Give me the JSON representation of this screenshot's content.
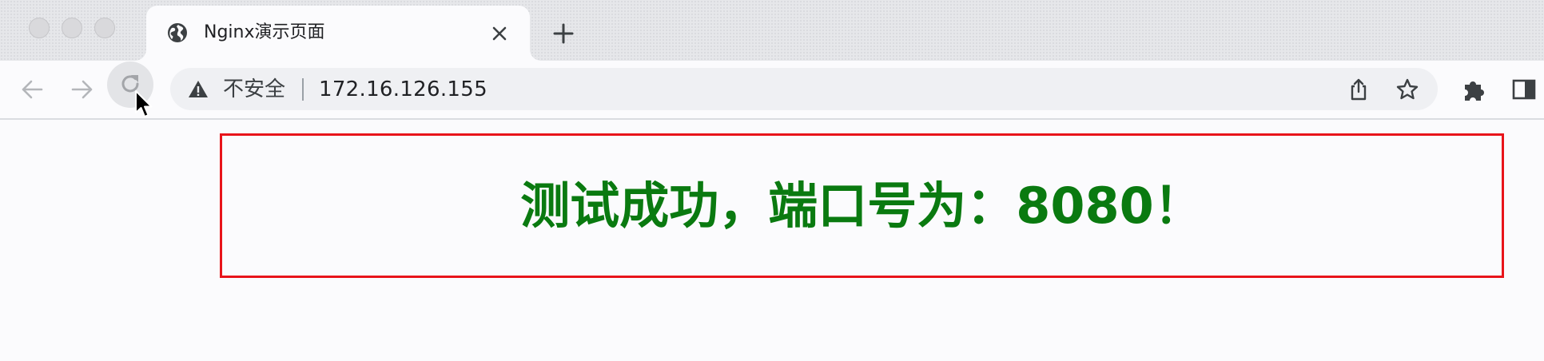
{
  "tab": {
    "title": "Nginx演示页面",
    "favicon": "globe-icon"
  },
  "toolbar": {
    "security_label": "不安全",
    "url": "172.16.126.155"
  },
  "page": {
    "headline": "测试成功，端口号为：8080！",
    "headline_color": "#0a7a10",
    "box_border_color": "#e8141a"
  }
}
